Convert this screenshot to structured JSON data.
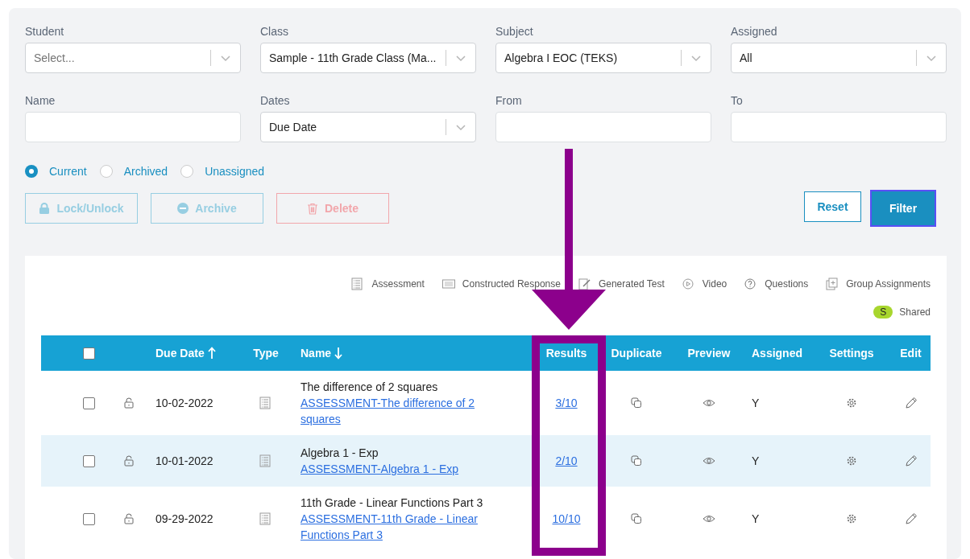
{
  "filters": [
    {
      "label": "Student",
      "kind": "select",
      "placeholder": "Select..."
    },
    {
      "label": "Class",
      "kind": "select",
      "value": "Sample - 11th Grade Class (Ma..."
    },
    {
      "label": "Subject",
      "kind": "select",
      "value": "Algebra I EOC (TEKS)"
    },
    {
      "label": "Assigned",
      "kind": "select",
      "value": "All"
    },
    {
      "label": "Name",
      "kind": "input"
    },
    {
      "label": "Dates",
      "kind": "select",
      "value": "Due Date"
    },
    {
      "label": "From",
      "kind": "input"
    },
    {
      "label": "To",
      "kind": "input"
    }
  ],
  "status_options": [
    {
      "label": "Current",
      "selected": true
    },
    {
      "label": "Archived",
      "selected": false
    },
    {
      "label": "Unassigned",
      "selected": false
    }
  ],
  "bulk_actions": [
    {
      "label": "Lock/Unlock",
      "kind": "lock",
      "disabled": true
    },
    {
      "label": "Archive",
      "kind": "archive",
      "disabled": true
    },
    {
      "label": "Delete",
      "kind": "delete",
      "disabled": true
    }
  ],
  "form_buttons": [
    {
      "label": "Reset",
      "kind": "outline"
    },
    {
      "label": "Filter",
      "kind": "primary"
    }
  ],
  "legend": [
    {
      "label": "Assessment",
      "kind": "assessment"
    },
    {
      "label": "Constructed Response",
      "kind": "constructed"
    },
    {
      "label": "Generated Test",
      "kind": "generated"
    },
    {
      "label": "Video",
      "kind": "video"
    },
    {
      "label": "Questions",
      "kind": "questions"
    },
    {
      "label": "Group Assignments",
      "kind": "group"
    }
  ],
  "shared_badge": {
    "letter": "S",
    "label": "Shared"
  },
  "table": {
    "select_all_checked": false,
    "columns": [
      {
        "label": "Due Date",
        "kind": "sort_ascending"
      },
      {
        "label": "Type",
        "kind": "plain"
      },
      {
        "label": "Name",
        "kind": "sort_descending"
      },
      {
        "label": "Results",
        "kind": "plain"
      },
      {
        "label": "Duplicate",
        "kind": "plain"
      },
      {
        "label": "Preview",
        "kind": "plain"
      },
      {
        "label": "Assigned",
        "kind": "plain"
      },
      {
        "label": "Settings",
        "kind": "plain"
      },
      {
        "label": "Edit",
        "kind": "plain"
      }
    ],
    "rows": [
      {
        "checked": false,
        "locked": false,
        "due_date": "10-02-2022",
        "kind": "assessment",
        "title": "The difference of 2 squares",
        "link": "ASSESSMENT-The difference of 2 squares",
        "results": "3/10",
        "assigned": "Y"
      },
      {
        "checked": false,
        "locked": false,
        "due_date": "10-01-2022",
        "kind": "assessment",
        "title": "Algebra 1 - Exp",
        "link": "ASSESSMENT-Algebra 1 - Exp",
        "results": "2/10",
        "assigned": "Y"
      },
      {
        "checked": false,
        "locked": false,
        "due_date": "09-29-2022",
        "kind": "assessment",
        "title": "11th Grade - Linear Functions Part 3",
        "link": "ASSESSMENT-11th Grade - Linear Functions Part 3",
        "results": "10/10",
        "assigned": "Y"
      }
    ]
  }
}
